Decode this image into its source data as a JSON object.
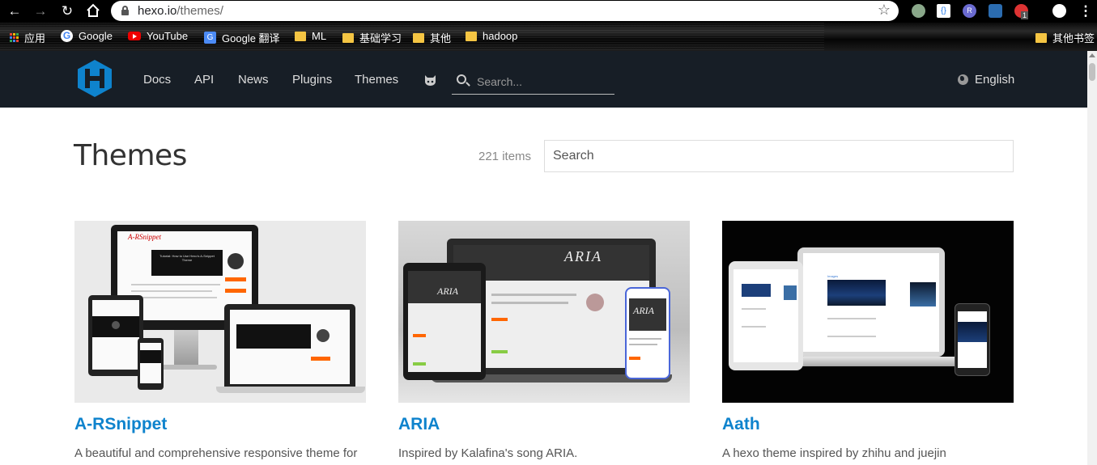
{
  "browser": {
    "url_host": "hexo.io",
    "url_path": "/themes/",
    "bookmarks": [
      "应用",
      "Google",
      "YouTube",
      "Google 翻译",
      "ML",
      "基础学习",
      "其他",
      "hadoop"
    ],
    "other_bookmarks": "其他书签",
    "ext_badge": "1"
  },
  "header": {
    "nav": [
      "Docs",
      "API",
      "News",
      "Plugins",
      "Themes"
    ],
    "search_placeholder": "Search...",
    "language": "English"
  },
  "page": {
    "title": "Themes",
    "count": "221 items",
    "search_placeholder": "Search"
  },
  "themes": [
    {
      "name": "A-RSnippet",
      "description": "A beautiful and comprehensive responsive theme for",
      "screen_brand": "A-RSnippet",
      "screen_headline": "Tutorial: How to Use Hexo's A-Snippet Theme"
    },
    {
      "name": "ARIA",
      "description": "Inspired by Kalafina's song ARIA.",
      "screen_brand": "ARIA"
    },
    {
      "name": "Aath",
      "description": "A hexo theme inspired by zhihu and juejin",
      "screen_brand": "Images"
    }
  ],
  "colors": {
    "header_bg": "#171e26",
    "link": "#0e83cd",
    "logo": "#0e83cd"
  }
}
